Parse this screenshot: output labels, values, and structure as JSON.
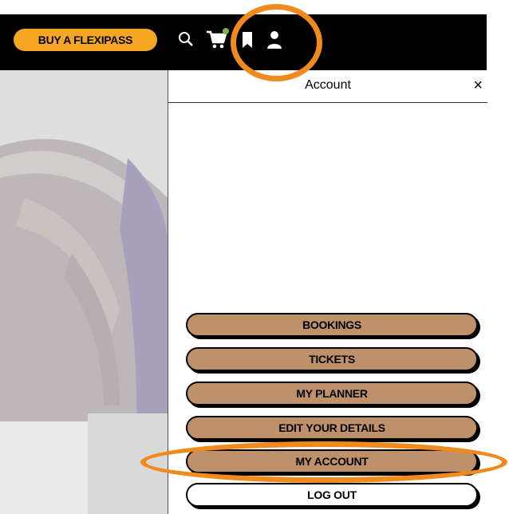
{
  "header": {
    "flexipass_label": "BUY A FLEXIPASS",
    "icons": [
      "search-icon",
      "cart-icon",
      "bookmark-icon",
      "user-icon"
    ]
  },
  "panel": {
    "title": "Account",
    "close_label": "×",
    "menu": [
      {
        "label": "BOOKINGS"
      },
      {
        "label": "TICKETS"
      },
      {
        "label": "MY PLANNER"
      },
      {
        "label": "EDIT YOUR DETAILS"
      },
      {
        "label": "MY ACCOUNT"
      },
      {
        "label": "LOG OUT"
      }
    ]
  },
  "colors": {
    "accent": "#f5a623",
    "menu_button": "#bf916a",
    "highlight_ring": "#f08a1c",
    "cart_badge": "#7ab648"
  }
}
